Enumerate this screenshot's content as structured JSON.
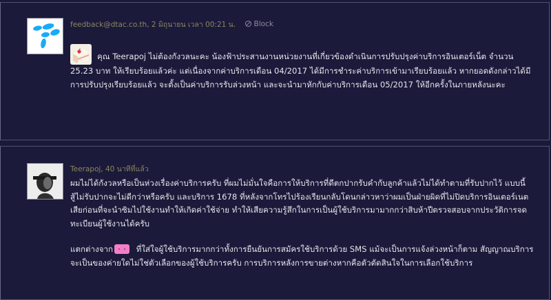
{
  "posts": [
    {
      "author": "feedback@dtac.co.th",
      "timestamp": ", 2 มิถุนายน เวลา 00:21 น.",
      "block_label": "Block",
      "avatar_icon": "telenor-logo-icon",
      "emoji_icon": "cake-icon",
      "lines": [
        "คุณ Teerapoj ไม่ต้องกังวลนะคะ น้องฟ้าประสานงานหน่วยงานที่เกี่ยวข้องดำเนินการปรับปรุงค่าบริการอินเตอร์เน็ต จำนวน",
        "25.23 บาท ให้เรียบร้อยแล้วค่ะ แต่เนื่องจากค่าบริการเดือน 04/2017 ได้มีการชำระค่าบริการเข้ามาเรียบร้อยแล้ว หากยอดดังกล่าวได้มี",
        "การปรับปรุงเรียบร้อยแล้ว จะตั้งเป็นค่าบริการรับล่วงหน้า และจะนำมาหักกับค่าบริการเดือน 05/2017 ให้อีกครั้งในภายหลังนะคะ"
      ]
    },
    {
      "author": "Teerapoj",
      "timestamp": ", 40 นาทีที่แล้ว",
      "avatar_icon": "user-photo-avatar",
      "emoji_icon": "pink-blob-icon",
      "paragraph1": [
        "ผมไม่ได้กังวลหรือเป็นห่วงเรื่องค่าบริการครับ  ที่ผมไม่มั่นใจคือการให้บริการที่ดีตกปากรับคำกับลูกค้าแล้วไม่ได้ทำตามที่รับปากไว้  แบบนี้",
        "สู้ไม่รับปากจะไม่ดีกว่าหรือครับ และบริการ 1678 ที่หลังจากโทรไปร้องเรียนกลับโดนกล่าวหาว่าผมเป็นฝ่ายผิดที่ไม่ปิดบริการอินเตอร์เนต",
        "เสียก่อนที่จะนำซิมไปใช้งานทำให้เกิดค่าใช้จ่าย ทำให้เสียความรู้สึกในการเป็นผู้ใช้บริการมามากกว่าสิบห้าปีตรวจสอบจากประวัติการจด",
        "ทะเบียนผู้ใช้งานได้ครับ"
      ],
      "paragraph2_start": "แตกต่างจาก",
      "paragraph2_rest": " ที่ใส่ใจผู้ใช้บริการมากกว่าทั้งการยืนยันการสมัครใช้บริการด้วย SMS แม้จะเป็นการแจ้งล่วงหน้าก็ตาม  สัญญาณบริการ",
      "paragraph2_line2": "จะเป็นของค่ายใดไม่ใช่ตัวเลือกของผู้ใช้บริการครับ การบริการหลังการขายต่างหากคือตัวตัดสินใจในการเลือกใช้บริการ"
    }
  ],
  "colors": {
    "background": "#1b1938",
    "meta_text": "#8a8760",
    "body_text": "#e6e6ee",
    "telenor_blue": "#19aaf8"
  }
}
